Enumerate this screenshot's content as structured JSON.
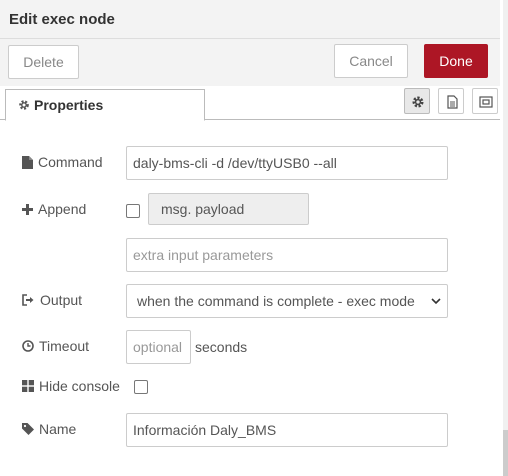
{
  "header": {
    "title": "Edit exec node"
  },
  "toolbar": {
    "delete_label": "Delete",
    "cancel_label": "Cancel",
    "done_label": "Done"
  },
  "tabs": {
    "properties_label": "Properties"
  },
  "form": {
    "command": {
      "label": "Command",
      "value": "daly-bms-cli  -d /dev/ttyUSB0 --all"
    },
    "append": {
      "label": "Append",
      "payload_label": "msg. payload",
      "extra_placeholder": "extra input parameters"
    },
    "output": {
      "label": "Output",
      "selected": "when the command is complete - exec mode"
    },
    "timeout": {
      "label": "Timeout",
      "placeholder": "optional",
      "unit": "seconds"
    },
    "hide_console": {
      "label": "Hide console"
    },
    "name": {
      "label": "Name",
      "value": "Información Daly_BMS"
    }
  },
  "colors": {
    "done_button": "#ad1625",
    "header_bg": "#f3f3f3"
  }
}
